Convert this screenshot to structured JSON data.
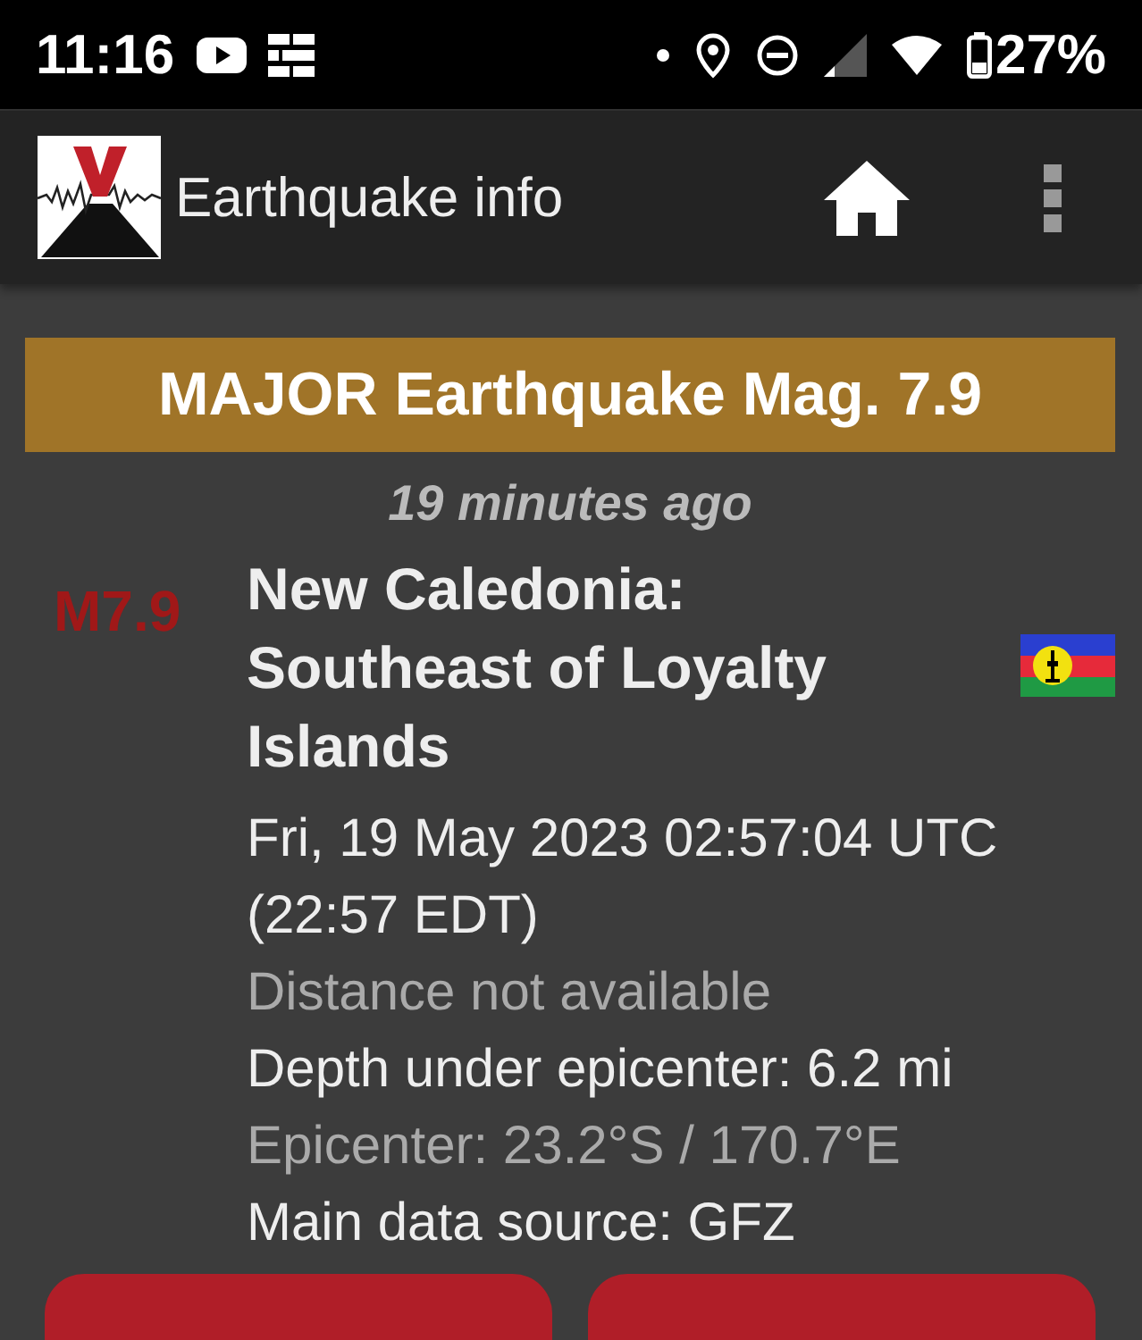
{
  "status_bar": {
    "time": "11:16",
    "battery": "27%"
  },
  "app_bar": {
    "title": "Earthquake info"
  },
  "alert": {
    "banner": "MAJOR Earthquake Mag. 7.9",
    "age": "19 minutes ago"
  },
  "quake": {
    "magnitude": "M7.9",
    "region": "New Caledonia: Southeast of Loyalty Islands",
    "details": [
      {
        "text": "Fri, 19 May 2023 02:57:04 UTC (22:57 EDT)",
        "dim": false
      },
      {
        "text": "Distance not available",
        "dim": true
      },
      {
        "text": "Depth under epicenter: 6.2 mi",
        "dim": false
      },
      {
        "text": "Epicenter: 23.2°S / 170.7°E",
        "dim": true
      },
      {
        "text": "Main data source: GFZ",
        "dim": false
      }
    ]
  },
  "action_buttons": [
    {
      "kind": "button"
    },
    {
      "kind": "button"
    }
  ]
}
